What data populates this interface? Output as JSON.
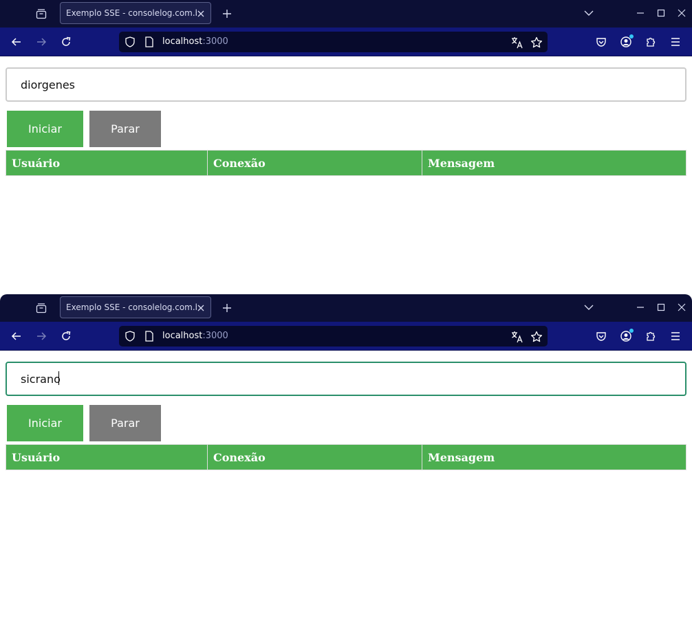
{
  "windows": [
    {
      "tab_title": "Exemplo SSE - consolelog.com.br",
      "url_host": "localhost",
      "url_port": ":3000",
      "input_value": "diorgenes",
      "buttons": {
        "start": "Iniciar",
        "stop": "Parar"
      },
      "table_headers": [
        "Usuário",
        "Conexão",
        "Mensagem"
      ]
    },
    {
      "tab_title": "Exemplo SSE - consolelog.com.br",
      "url_host": "localhost",
      "url_port": ":3000",
      "input_value": "sicrano",
      "buttons": {
        "start": "Iniciar",
        "stop": "Parar"
      },
      "table_headers": [
        "Usuário",
        "Conexão",
        "Mensagem"
      ]
    }
  ],
  "icons": {
    "tab_list": "tab-list-icon",
    "close": "close-icon",
    "new_tab": "plus-icon",
    "list_all_tabs": "chevron-down-icon",
    "minimize": "minimize-icon",
    "maximize": "maximize-icon",
    "window_close": "close-icon",
    "back": "arrow-left-icon",
    "forward": "arrow-right-icon",
    "reload": "reload-icon",
    "shield": "shield-icon",
    "page": "page-icon",
    "translate": "translate-icon",
    "bookmark": "star-icon",
    "pocket": "pocket-icon",
    "account": "account-icon",
    "extensions": "puzzle-icon",
    "menu": "hamburger-menu-icon"
  },
  "colors": {
    "titlebar": "#0c0f35",
    "navbar": "#111779",
    "urlbar": "#070a2c",
    "accent_green": "#4caf50",
    "stop_gray": "#7a7a7a",
    "focus_border": "#2a8f6a",
    "notification_dot": "#35c5f4"
  }
}
